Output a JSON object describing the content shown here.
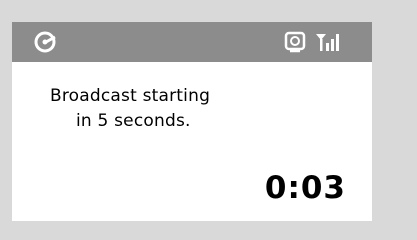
{
  "status_bar": {
    "icons": [
      "radio-mode-icon",
      "broadcast-icon",
      "signal-strength-icon"
    ]
  },
  "message": {
    "line1": "Broadcast starting",
    "line2": "in 5 seconds."
  },
  "countdown": {
    "value": "0:03"
  },
  "colors": {
    "status_bar_bg": "#8c8c8c",
    "frame_bg": "#d9d9d9",
    "screen_bg": "#ffffff",
    "text": "#000000"
  }
}
